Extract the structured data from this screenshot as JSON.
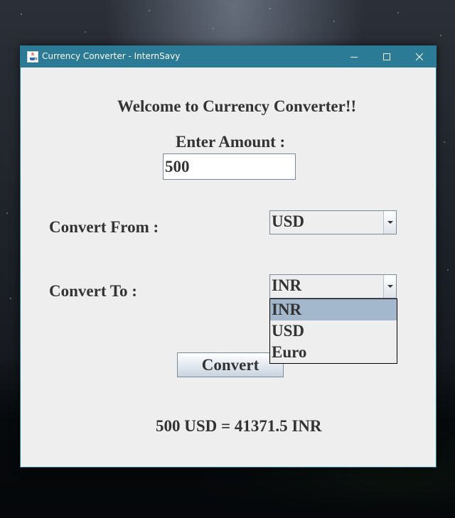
{
  "window": {
    "title": "Currency Converter - InternSavy",
    "accent_color": "#2b7a96",
    "controls": {
      "minimize_icon": "minimize-icon",
      "maximize_icon": "maximize-icon",
      "close_icon": "close-icon"
    }
  },
  "form": {
    "welcome": "Welcome to Currency Converter!!",
    "amount_label": "Enter Amount :",
    "amount_value": "500",
    "from_label": "Convert From :",
    "from_selected": "USD",
    "to_label": "Convert To :",
    "to_selected": "INR",
    "to_options": [
      "INR",
      "USD",
      "Euro"
    ],
    "to_highlighted_index": 0,
    "convert_label": "Convert",
    "result": "500 USD = 41371.5 INR"
  },
  "colors": {
    "window_bg": "#eeeeee",
    "text": "#333333",
    "dropdown_highlight": "#a3b8cc"
  }
}
